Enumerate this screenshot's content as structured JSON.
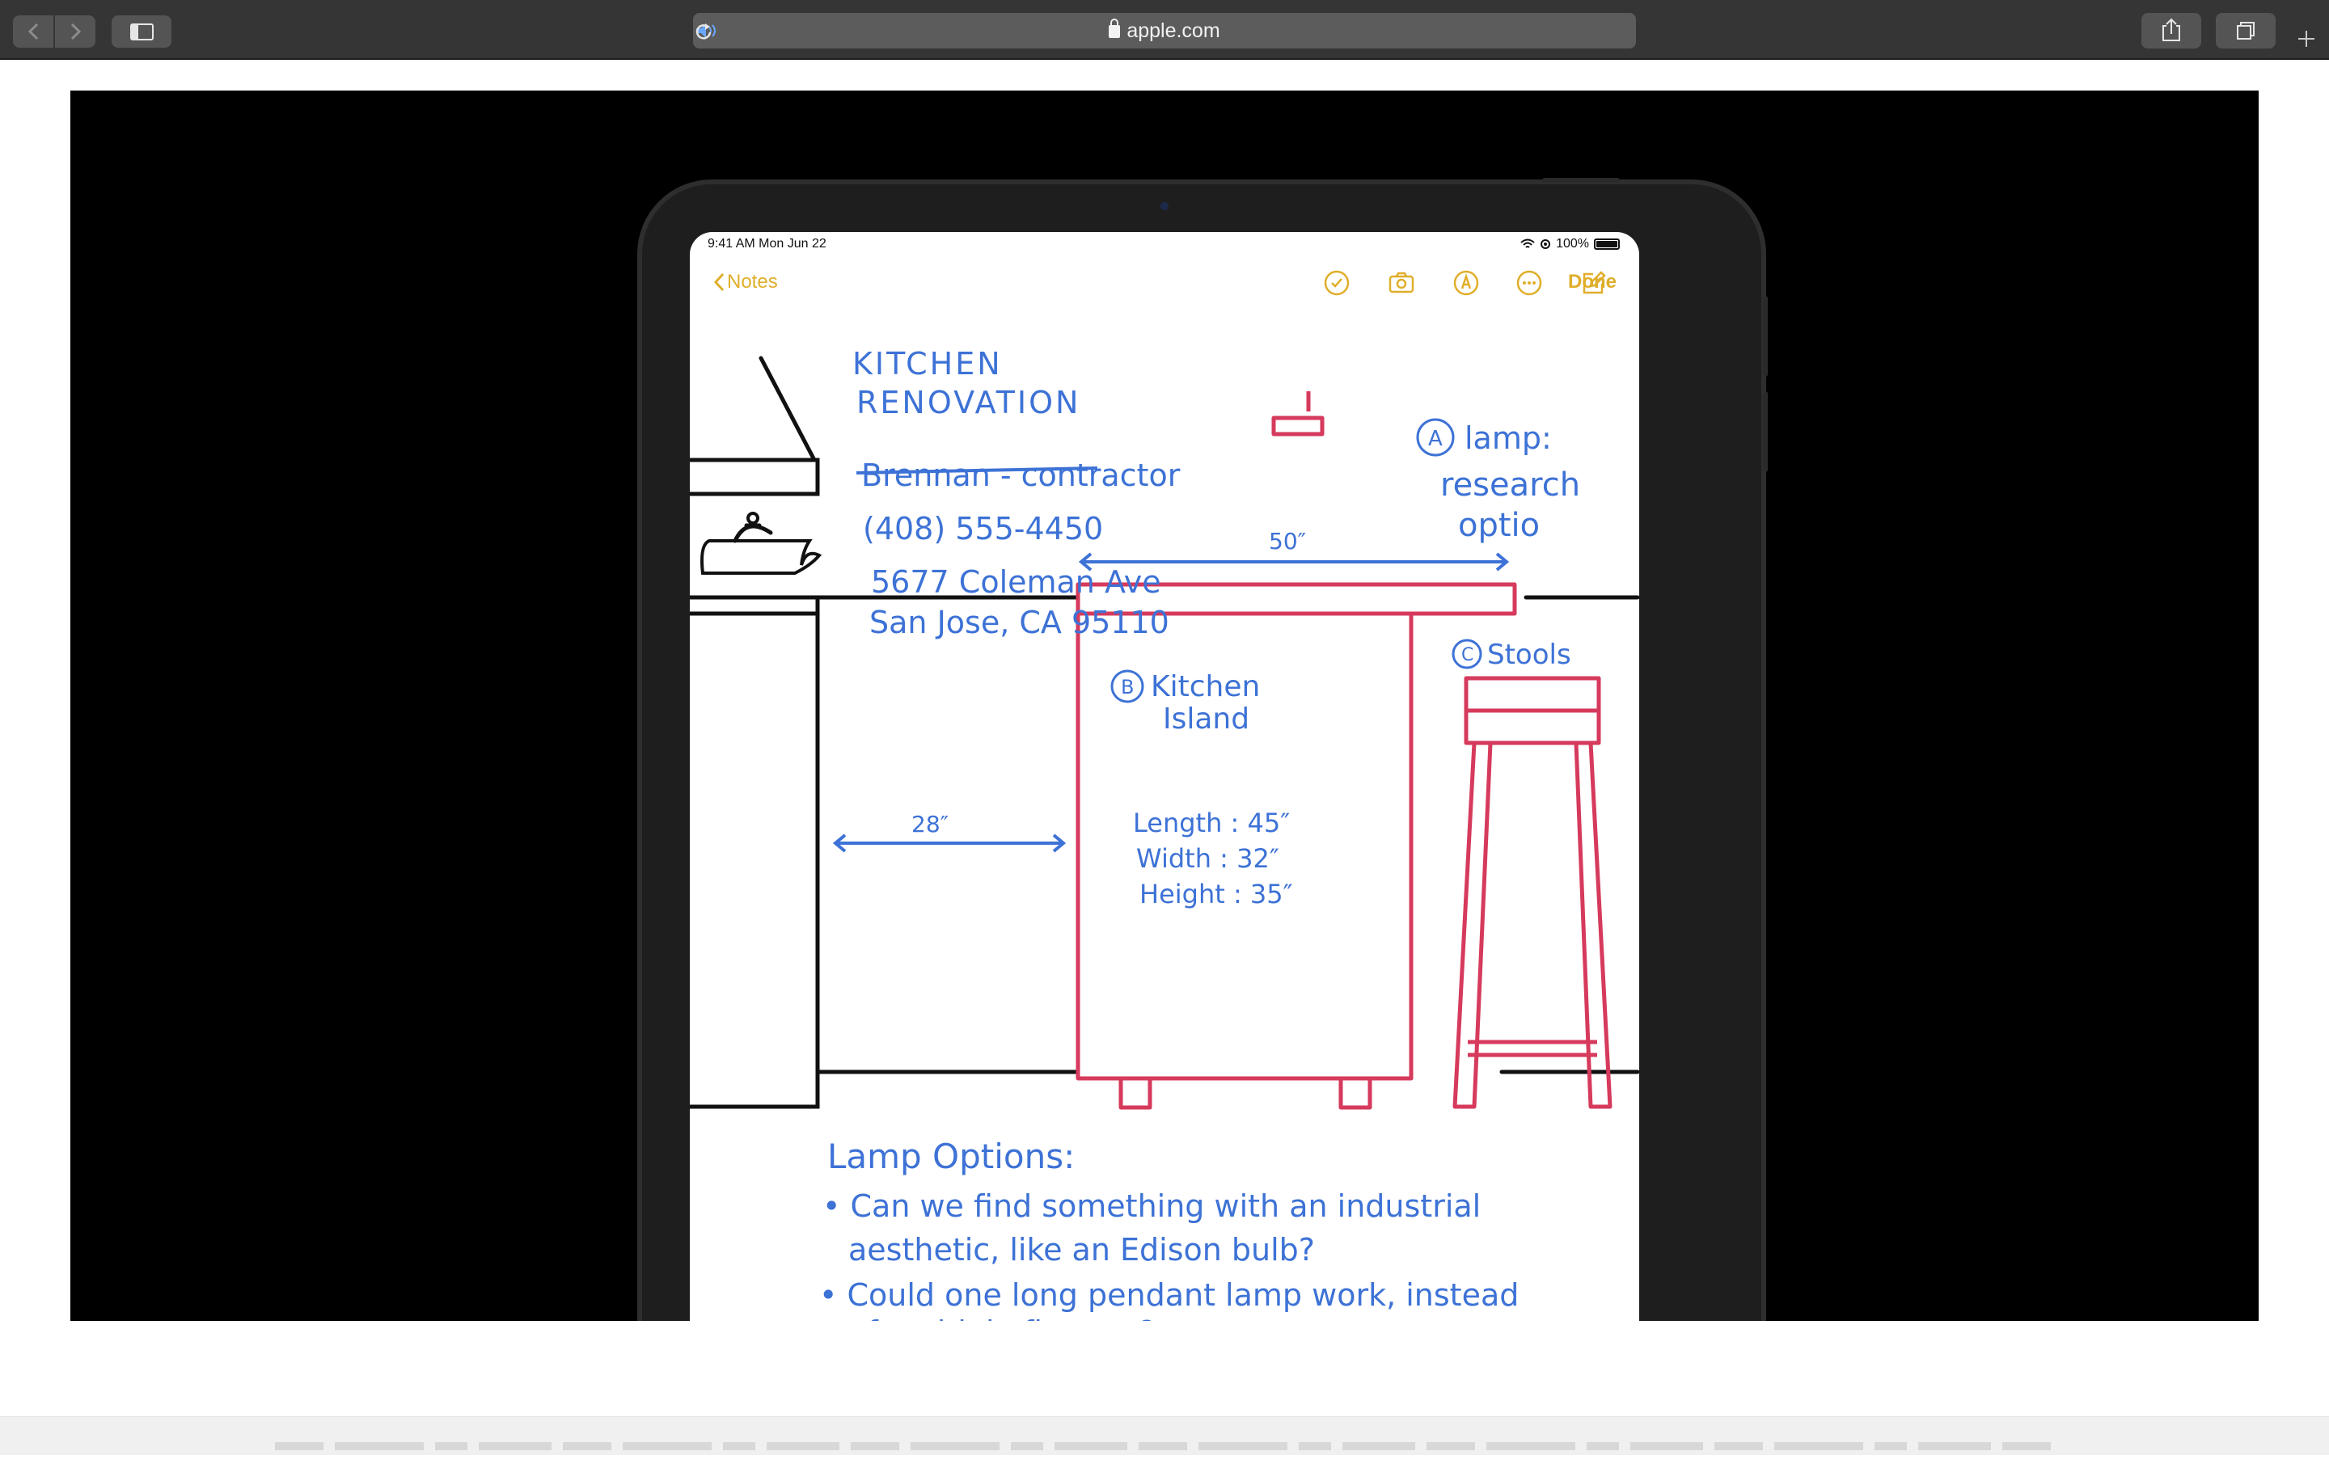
{
  "browser": {
    "url": "apple.com",
    "icons": [
      "chevron-left-icon",
      "chevron-right-icon",
      "sidebar-icon",
      "lock-icon",
      "speaker-icon",
      "reload-icon",
      "share-icon",
      "tabs-icon",
      "plus-icon"
    ]
  },
  "ipad_status": {
    "time": "9:41 AM   Mon Jun 22",
    "battery": "100%"
  },
  "notes_nav": {
    "back_label": "Notes",
    "done_label": "Done",
    "tools": [
      "checklist-icon",
      "camera-icon",
      "markup-icon",
      "more-icon",
      "compose-icon"
    ]
  },
  "note": {
    "title_line1": "KITCHEN",
    "title_line2": "RENOVATION",
    "contractor": "Brennan - contractor",
    "phone": "(408) 555-4450",
    "address_line1": "5677 Coleman Ave",
    "address_line2": "San Jose, CA 95110",
    "lamp_marker": "A",
    "lamp_label": "lamp:",
    "lamp_research1": "research",
    "lamp_research2": "optio",
    "dim_width": "50″",
    "dim_gap": "28″",
    "island_marker": "B",
    "island_label1": "Kitchen",
    "island_label2": "Island",
    "island_length": "Length : 45″",
    "island_width": "Width : 32″",
    "island_height": "Height : 35″",
    "stools_marker": "C",
    "stools_label": "Stools",
    "options_title": "Lamp Options:",
    "bullet1_line1": "• Can we find something with an industrial",
    "bullet1_line2": "aesthetic, like an Edison bulb?",
    "bullet2_line1": "• Could one long pendant lamp work, instead",
    "bullet2_line2": "of multiple fixtures?"
  },
  "colors": {
    "toolbar": "#353535",
    "ink_blue": "#3d72d6",
    "ink_red": "#d63a5c",
    "notes_accent": "#e0ae2a"
  }
}
